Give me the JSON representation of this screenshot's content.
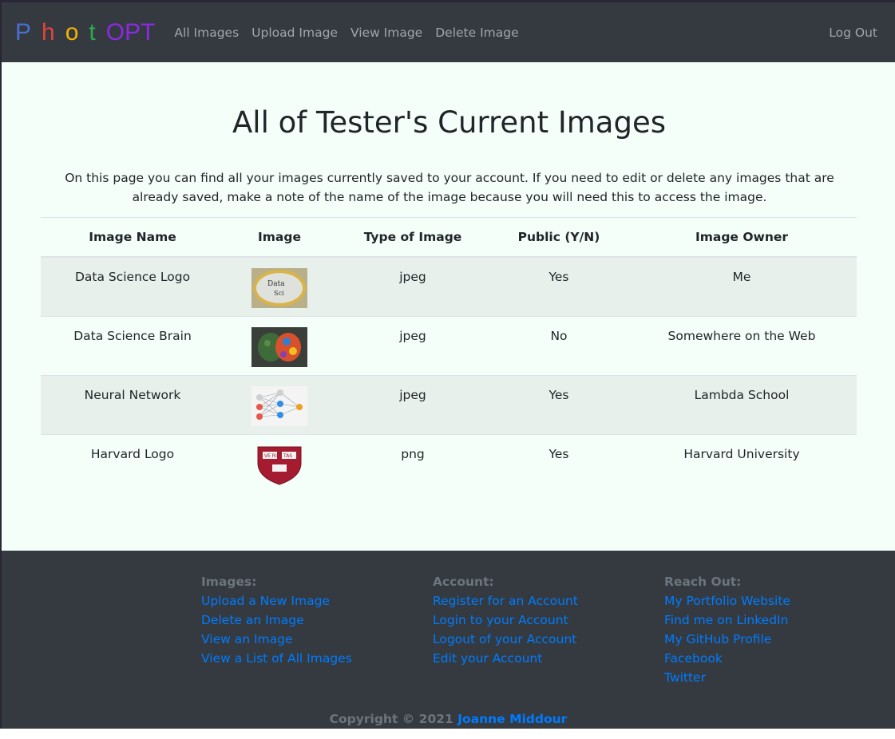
{
  "brand": {
    "letters": [
      "P",
      "h",
      "o",
      "t",
      "OPT"
    ],
    "colors": [
      "#4a6fd1",
      "#e0453a",
      "#f4b400",
      "#2fa84f",
      "#8a2be2"
    ]
  },
  "nav": {
    "links": [
      "All Images",
      "Upload Image",
      "View Image",
      "Delete Image"
    ],
    "logout": "Log Out"
  },
  "main": {
    "title": "All of Tester's Current Images",
    "intro": "On this page you can find all your images currently saved to your account. If you need to edit or delete any images that are already saved, make a note of the name of the image because you will need this to access the image."
  },
  "table": {
    "headers": [
      "Image Name",
      "Image",
      "Type of Image",
      "Public (Y/N)",
      "Image Owner"
    ],
    "rows": [
      {
        "name": "Data Science Logo",
        "thumb": "data-science-logo-thumbnail",
        "type": "jpeg",
        "public": "Yes",
        "owner": "Me"
      },
      {
        "name": "Data Science Brain",
        "thumb": "data-science-brain-thumbnail",
        "type": "jpeg",
        "public": "No",
        "owner": "Somewhere on the Web"
      },
      {
        "name": "Neural Network",
        "thumb": "neural-network-thumbnail",
        "type": "jpeg",
        "public": "Yes",
        "owner": "Lambda School"
      },
      {
        "name": "Harvard Logo",
        "thumb": "harvard-logo-thumbnail",
        "type": "png",
        "public": "Yes",
        "owner": "Harvard University"
      }
    ]
  },
  "footer": {
    "images": {
      "heading": "Images:",
      "links": [
        "Upload a New Image",
        "Delete an Image",
        "View an Image",
        "View a List of All Images"
      ]
    },
    "account": {
      "heading": "Account:",
      "links": [
        "Register for an Account",
        "Login to your Account",
        "Logout of your Account",
        "Edit your Account"
      ]
    },
    "reach": {
      "heading": "Reach Out:",
      "links": [
        "My Portfolio Website",
        "Find me on LinkedIn",
        "My GitHub Profile",
        "Facebook",
        "Twitter"
      ]
    },
    "copyright": "Copyright © 2021",
    "author": "Joanne Middour"
  },
  "colors": {
    "navbar": "#343a40",
    "page_bg": "#f5fffa",
    "link": "#007bff",
    "muted": "#a0a6ab"
  }
}
